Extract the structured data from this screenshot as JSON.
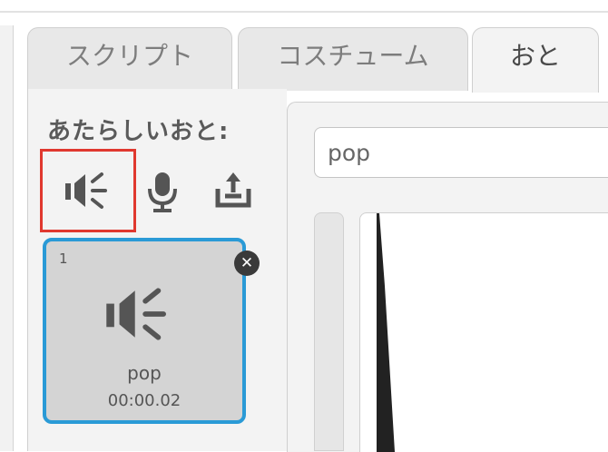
{
  "tabs": [
    {
      "label": "スクリプト"
    },
    {
      "label": "コスチューム"
    },
    {
      "label": "おと",
      "active": true
    }
  ],
  "sidebar": {
    "new_sound_label": "あたらしいおと:",
    "buttons": [
      {
        "icon": "speaker-icon",
        "label": "choose-sound-from-library"
      },
      {
        "icon": "microphone-icon",
        "label": "record-sound"
      },
      {
        "icon": "upload-icon",
        "label": "upload-sound"
      }
    ]
  },
  "sounds": [
    {
      "index": "1",
      "name": "pop",
      "duration": "00:00.02",
      "selected": true
    }
  ],
  "editor": {
    "sound_name_value": "pop"
  },
  "colors": {
    "selection_border": "#2a9ad6",
    "highlight_box": "#e0382f",
    "panel_bg": "#f3f3f3"
  }
}
